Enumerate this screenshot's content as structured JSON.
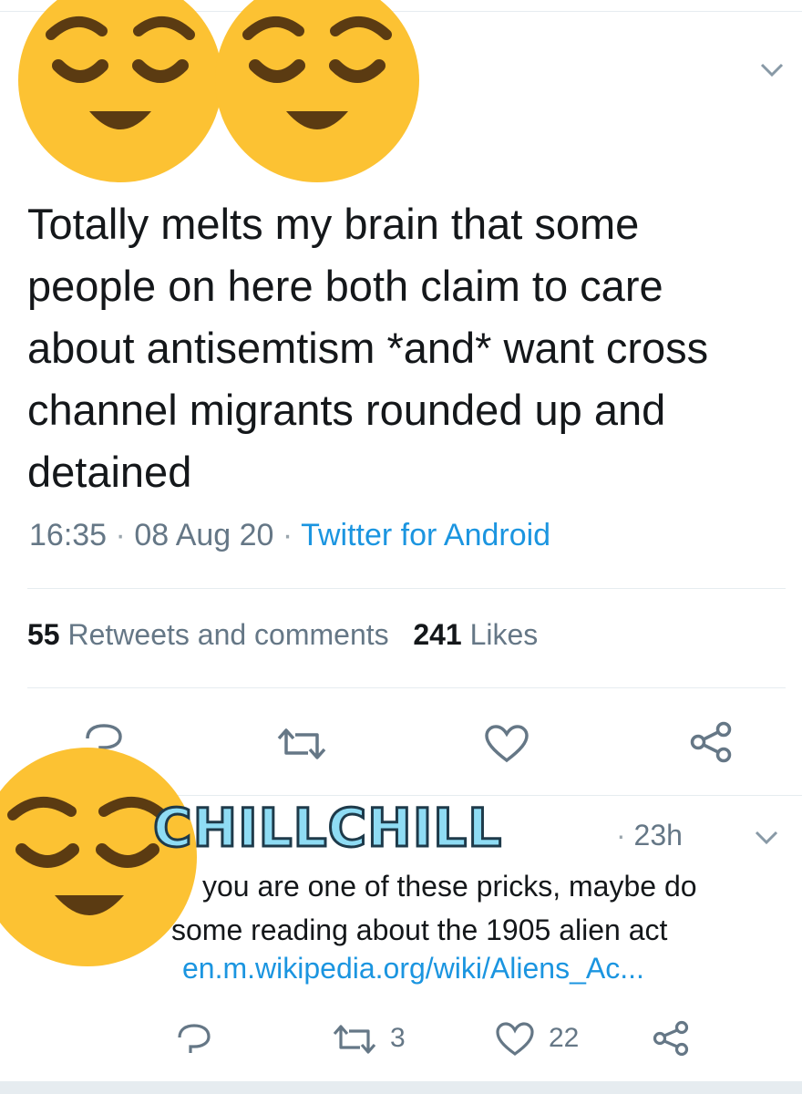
{
  "tweet": {
    "text": "Totally melts my brain that some people on here both claim to care about antisemtism *and* want cross channel migrants rounded up and detained",
    "time": "16:35",
    "date": "08 Aug 20",
    "source": "Twitter for Android",
    "retweets_count": "55",
    "retweets_label": "Retweets and comments",
    "likes_count": "241",
    "likes_label": "Likes"
  },
  "reply": {
    "timestamp": "23h",
    "text_line1": "you are one of these pricks, maybe do",
    "text_line2": "some reading about the 1905 alien act",
    "link": "en.m.wikipedia.org/wiki/Aliens_Ac...",
    "retweet_count": "3",
    "like_count": "22"
  },
  "overlay": {
    "sticker_text": "CHILLCHILL"
  },
  "icons": {
    "reply": "reply-icon",
    "retweet": "retweet-icon",
    "like": "heart-icon",
    "share": "share-icon",
    "menu": "chevron-down-icon",
    "emoji": "relieved-face-emoji"
  },
  "colors": {
    "link": "#1b95e0",
    "secondary_text": "#657786",
    "primary_text": "#14171a",
    "divider": "#e6ecf0",
    "icon": "#657786",
    "emoji": "#fcc233"
  }
}
